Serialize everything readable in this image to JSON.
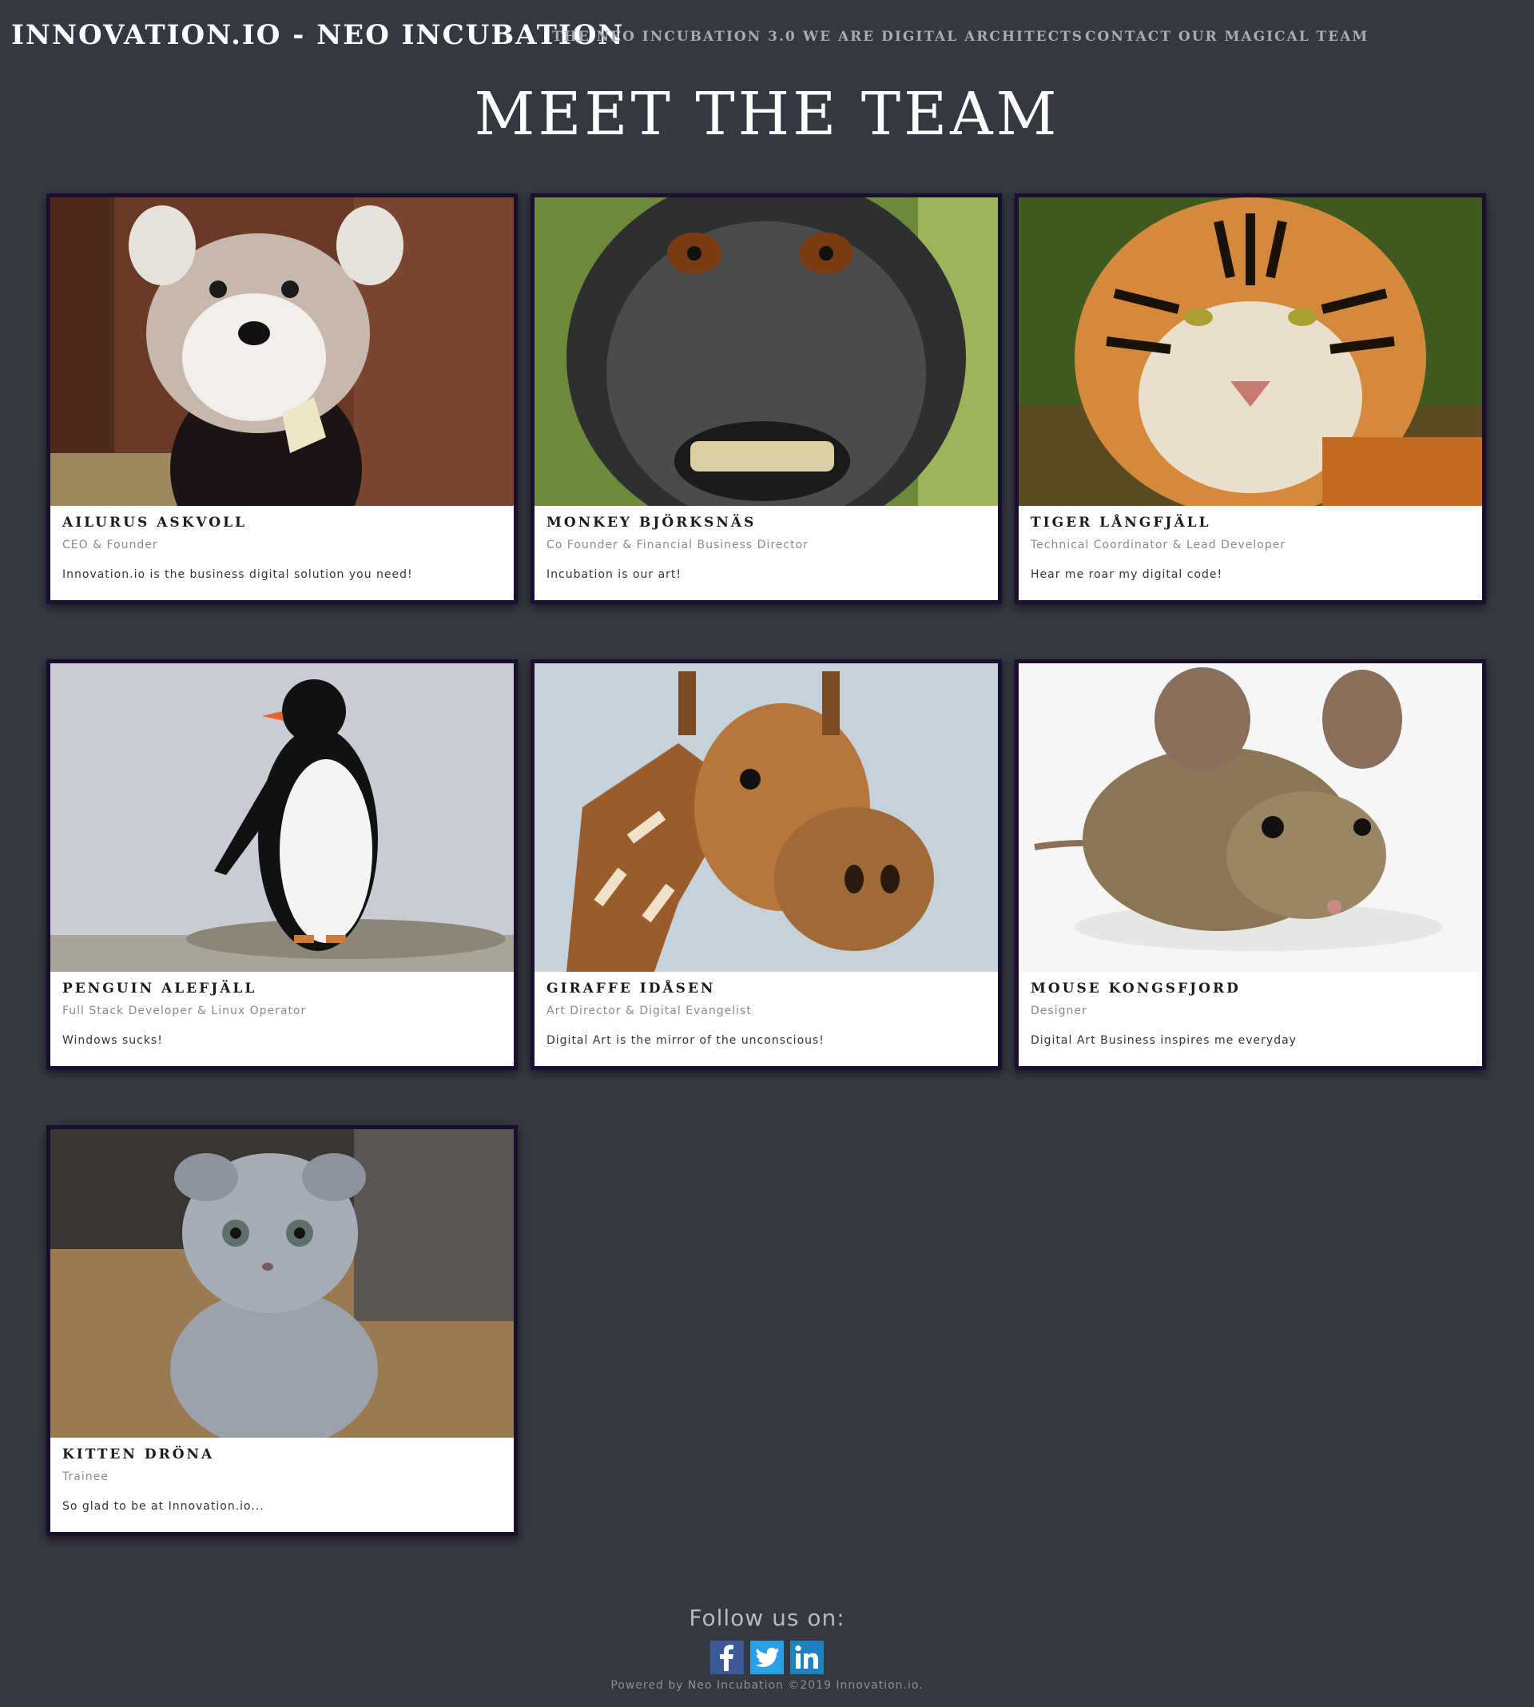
{
  "nav": {
    "brand": "INNOVATION.IO - NEO INCUBATION",
    "links": [
      "THE NEO INCUBATION 3.0",
      "WE ARE DIGITAL ARCHITECTS",
      "CONTACT OUR MAGICAL TEAM"
    ]
  },
  "page_title": "MEET THE TEAM",
  "team": [
    {
      "name": "AILURUS ASKVOLL",
      "role": "CEO & Founder",
      "quote": "Innovation.io is the business digital solution you need!",
      "photo": "red-panda-photo"
    },
    {
      "name": "MONKEY BJÖRKSNÄS",
      "role": "Co Founder & Financial Business Director",
      "quote": "Incubation is our art!",
      "photo": "macaque-photo"
    },
    {
      "name": "TIGER LÅNGFJÄLL",
      "role": "Technical Coordinator & Lead Developer",
      "quote": "Hear me roar my digital code!",
      "photo": "tiger-photo"
    },
    {
      "name": "PENGUIN ALEFJÄLL",
      "role": "Full Stack Developer & Linux Operator",
      "quote": "Windows sucks!",
      "photo": "penguin-photo"
    },
    {
      "name": "GIRAFFE IDÅSEN",
      "role": "Art Director & Digital Evangelist",
      "quote": "Digital Art is the mirror of the unconscious!",
      "photo": "giraffe-photo"
    },
    {
      "name": "MOUSE KONGSFJORD",
      "role": "Designer",
      "quote": "Digital Art Business inspires me everyday",
      "photo": "mouse-photo"
    },
    {
      "name": "KITTEN DRÖNA",
      "role": "Trainee",
      "quote": "So glad to be at Innovation.io...",
      "photo": "kitten-photo"
    }
  ],
  "footer": {
    "follow_label": "Follow us on:",
    "social": [
      "facebook-icon",
      "twitter-icon",
      "linkedin-icon"
    ],
    "powered": "Powered by Neo Incubation ©2019 Innovation.io."
  },
  "colors": {
    "background": "#343840",
    "card_border": "#1a0f2e",
    "nav_link": "#a9acb2"
  }
}
